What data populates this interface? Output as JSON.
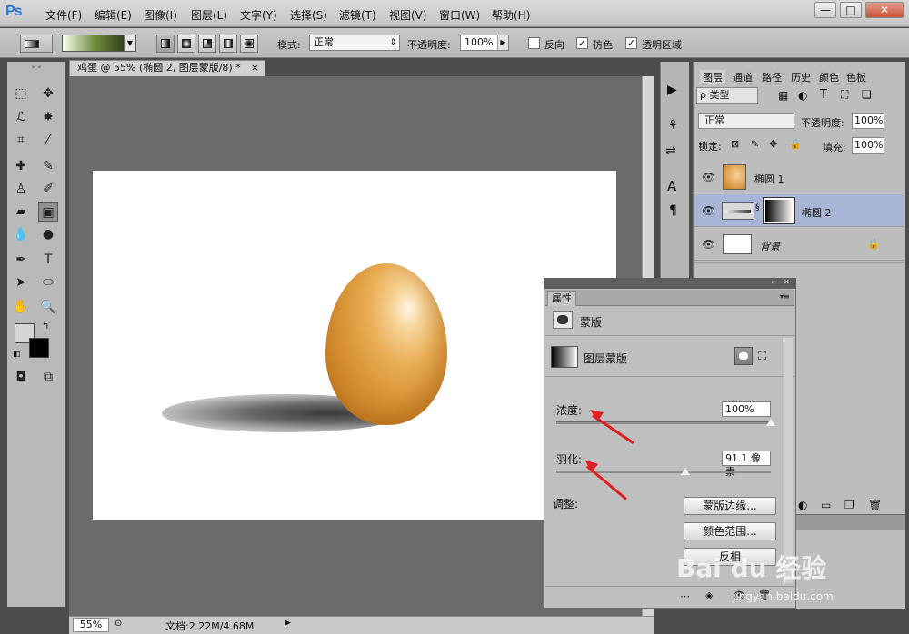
{
  "app": {
    "logo": "Ps"
  },
  "menu": [
    "文件(F)",
    "编辑(E)",
    "图像(I)",
    "图层(L)",
    "文字(Y)",
    "选择(S)",
    "滤镜(T)",
    "视图(V)",
    "窗口(W)",
    "帮助(H)"
  ],
  "window_controls": {
    "minimize": "—",
    "restore": "□",
    "close": "✕"
  },
  "options": {
    "mode_label": "模式:",
    "mode_value": "正常",
    "opacity_label": "不透明度:",
    "opacity_value": "100%",
    "reverse_label": "反向",
    "reverse_checked": false,
    "dither_label": "仿色",
    "dither_checked": true,
    "transparency_label": "透明区域",
    "transparency_checked": true,
    "check_mark": "✓"
  },
  "document": {
    "tab_title": "鸡蛋 @ 55% (椭圆 2, 图层蒙版/8) *",
    "tab_close": "×",
    "zoom": "55%",
    "doc_info": "文档:2.22M/4.68M"
  },
  "layers_panel": {
    "tabs": [
      "图层",
      "通道",
      "路径",
      "历史",
      "颜色",
      "色板"
    ],
    "filter_label": "ρ 类型",
    "blend_mode": "正常",
    "opacity_label": "不透明度:",
    "opacity_value": "100%",
    "lock_label": "锁定:",
    "fill_label": "填充:",
    "fill_value": "100%",
    "layers": [
      {
        "name": "椭圆 1",
        "selected": false
      },
      {
        "name": "椭圆 2",
        "selected": true
      },
      {
        "name": "背景",
        "selected": false
      }
    ]
  },
  "properties_panel": {
    "tab": "属性",
    "mask_type": "蒙版",
    "layer_mask_label": "图层蒙版",
    "density_label": "浓度:",
    "density_value": "100%",
    "density": 1.0,
    "feather_label": "羽化:",
    "feather_value": "91.1 像素",
    "feather": 0.6,
    "adjust_label": "调整:",
    "mask_edge_button": "蒙版边缘...",
    "color_range_button": "颜色范围...",
    "invert_button": "反相"
  },
  "watermark": {
    "brand": "Bai du 经验",
    "url": "jingyan.baidu.com"
  },
  "colors": {
    "selected_layer": "#a7b6d6",
    "arrow": "#e02020",
    "ps_blue": "#2a7bd8"
  }
}
